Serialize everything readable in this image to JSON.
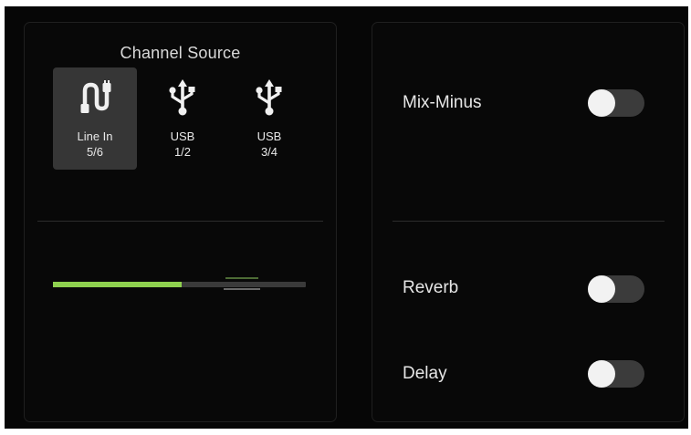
{
  "channel_source": {
    "title": "Channel Source",
    "options": [
      {
        "line1": "Line In",
        "line2": "5/6",
        "icon": "cable-icon",
        "selected": true
      },
      {
        "line1": "USB",
        "line2": "1/2",
        "icon": "usb-icon",
        "selected": false
      },
      {
        "line1": "USB",
        "line2": "3/4",
        "icon": "usb-icon",
        "selected": false
      }
    ]
  },
  "level_meter": {
    "level_fraction": 0.51,
    "fill_color": "#8fd14f"
  },
  "effects": {
    "mix_minus": {
      "label": "Mix-Minus",
      "enabled": false
    },
    "reverb": {
      "label": "Reverb",
      "enabled": false
    },
    "delay": {
      "label": "Delay",
      "enabled": false
    }
  },
  "colors": {
    "background": "#060606",
    "selected_button": "#363636",
    "toggle_off_track": "#3b3b3b",
    "toggle_knob": "#f2f2f2"
  }
}
